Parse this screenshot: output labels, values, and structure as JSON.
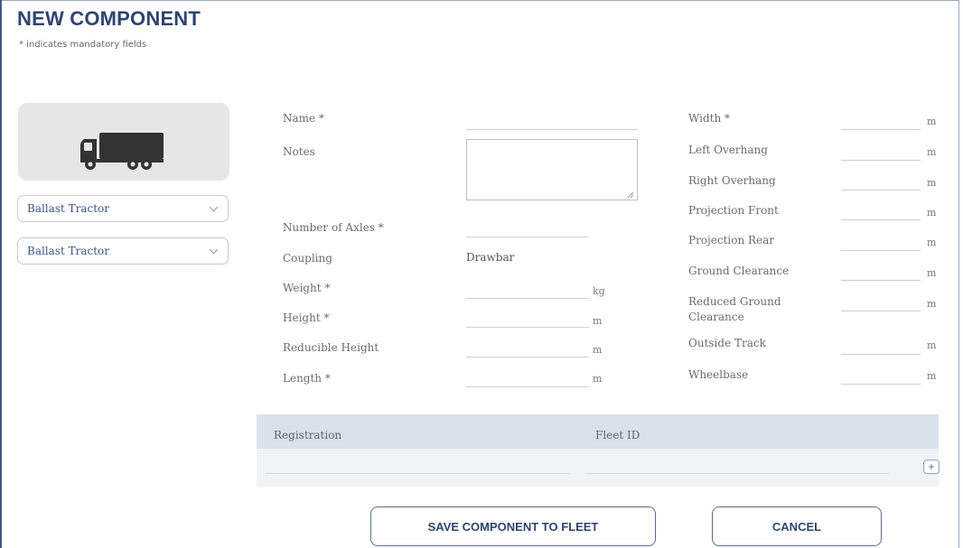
{
  "page": {
    "title": "NEW COMPONENT",
    "subtitle": "* indicates mandatory fields"
  },
  "vehicle": {
    "icon": "truck-icon",
    "type_select": "Ballast Tractor",
    "subtype_select": "Ballast Tractor"
  },
  "left_fields": {
    "name": "Name *",
    "notes": "Notes",
    "axles": "Number of Axles *",
    "coupling": "Coupling",
    "coupling_value": "Drawbar",
    "weight": "Weight *",
    "weight_unit": "kg",
    "height": "Height *",
    "height_unit": "m",
    "reducible_height": "Reducible Height",
    "reducible_height_unit": "m",
    "length": "Length *",
    "length_unit": "m"
  },
  "right_fields": {
    "width": "Width *",
    "left_overhang": "Left Overhang",
    "right_overhang": "Right Overhang",
    "projection_front": "Projection Front",
    "projection_rear": "Projection Rear",
    "ground_clearance": "Ground Clearance",
    "reduced_ground_clearance": "Reduced Ground Clearance",
    "outside_track": "Outside Track",
    "wheelbase": "Wheelbase",
    "unit": "m"
  },
  "registration_table": {
    "columns": [
      "Registration",
      "Fleet ID"
    ],
    "add_label": "+"
  },
  "actions": {
    "save": "SAVE COMPONENT TO FLEET",
    "cancel": "CANCEL"
  }
}
